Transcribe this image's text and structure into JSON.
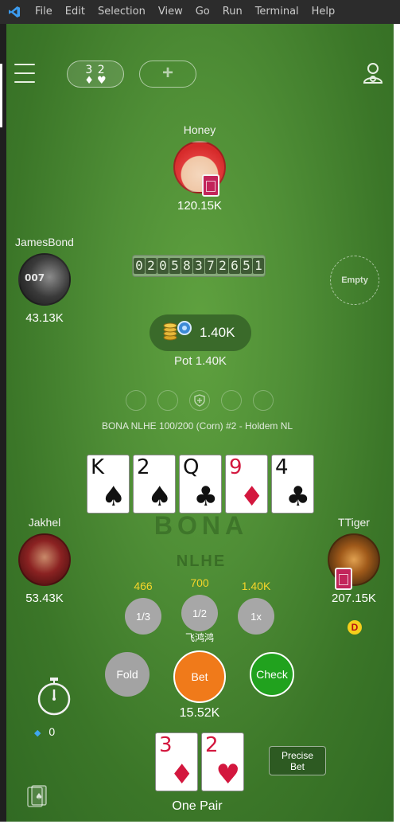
{
  "menubar": {
    "items": [
      "File",
      "Edit",
      "Selection",
      "View",
      "Go",
      "Run",
      "Terminal",
      "Help"
    ]
  },
  "topbar": {
    "deck_numbers": "3 2",
    "deck_suits": "♦ ♥",
    "add_label": "+"
  },
  "players": {
    "top": {
      "name": "Honey",
      "chips": "120.15K"
    },
    "left_top": {
      "name": "JamesBond",
      "chips": "43.13K",
      "avatar_text": "007"
    },
    "left_bottom": {
      "name": "Jakhel",
      "chips": "53.43K"
    },
    "right_bottom": {
      "name": "TTiger",
      "chips": "207.15K"
    },
    "right_top": {
      "empty_label": "Empty"
    }
  },
  "hand_counter": "02058372651",
  "pot": {
    "amount": "1.40K",
    "label": "Pot 1.40K"
  },
  "table_name": "BONA NLHE 100/200 (Corn) #2 - Holdem NL",
  "community_cards": [
    {
      "rank": "K",
      "suit": "♠",
      "color": "black"
    },
    {
      "rank": "2",
      "suit": "♠",
      "color": "black"
    },
    {
      "rank": "Q",
      "suit": "♣",
      "color": "black"
    },
    {
      "rank": "9",
      "suit": "♦",
      "color": "red"
    },
    {
      "rank": "4",
      "suit": "♣",
      "color": "black"
    }
  ],
  "logo": {
    "brand": "BONA",
    "variant": "NLHE"
  },
  "quick_bets": [
    {
      "value": "466",
      "label": "1/3"
    },
    {
      "value": "700",
      "label": "1/2"
    },
    {
      "value": "1.40K",
      "label": "1x"
    }
  ],
  "username": "飞鸿鸿",
  "actions": {
    "fold": "Fold",
    "bet": "Bet",
    "check": "Check"
  },
  "stake": "15.52K",
  "diamonds": "0",
  "hole_cards": [
    {
      "rank": "3",
      "suit": "♦",
      "color": "red"
    },
    {
      "rank": "2",
      "suit": "♥",
      "color": "red"
    }
  ],
  "precise_bet": "Precise Bet",
  "hand_name": "One Pair",
  "dealer_label": "D",
  "icons": [
    "vscode-icon",
    "hamburger-menu-icon",
    "profile-icon",
    "chips-icon",
    "shield-icon",
    "stopwatch-icon",
    "diamond-icon",
    "card-deck-icon"
  ],
  "colors": {
    "table": "#4f8e36",
    "bet": "#f07a1a",
    "check": "#21a21e",
    "quick_value": "#f5d52a",
    "red_suit": "#d3173e"
  }
}
